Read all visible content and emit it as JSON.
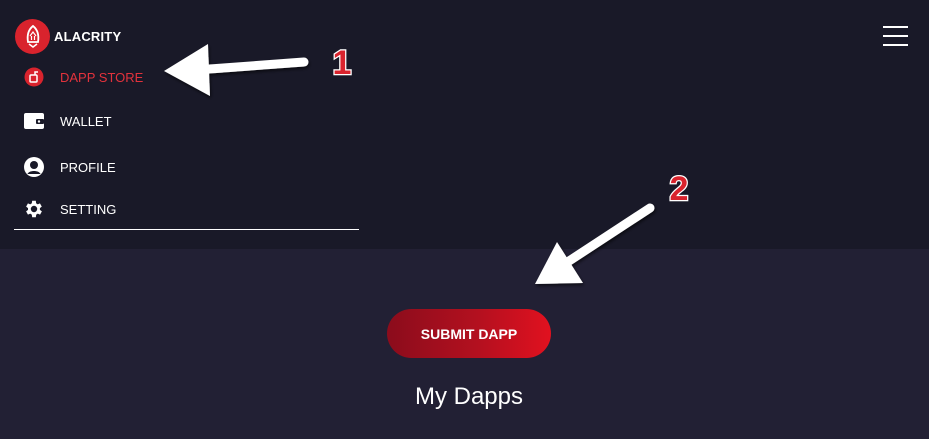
{
  "brand": {
    "name": "ALACRITY",
    "logo_icon": "rocket-icon",
    "logo_color": "#d9232d"
  },
  "header": {
    "menu_icon": "hamburger-menu-icon"
  },
  "sidebar": {
    "items": [
      {
        "label": "DAPP STORE",
        "icon": "dapp-store-icon",
        "active": true
      },
      {
        "label": "WALLET",
        "icon": "wallet-icon",
        "active": false
      },
      {
        "label": "PROFILE",
        "icon": "profile-icon",
        "active": false
      },
      {
        "label": "SETTING",
        "icon": "gear-icon",
        "active": false
      }
    ]
  },
  "main": {
    "submit_label": "SUBMIT DAPP",
    "section_title": "My Dapps"
  },
  "annotations": [
    {
      "number": "1",
      "points_to": "DAPP STORE"
    },
    {
      "number": "2",
      "points_to": "SUBMIT DAPP"
    }
  ],
  "colors": {
    "accent": "#e2323c",
    "header_bg": "#191928",
    "content_bg": "#222034",
    "button_gradient_start": "#8b0c1c",
    "button_gradient_end": "#e1111f",
    "annotation_number": "#d9232d"
  }
}
